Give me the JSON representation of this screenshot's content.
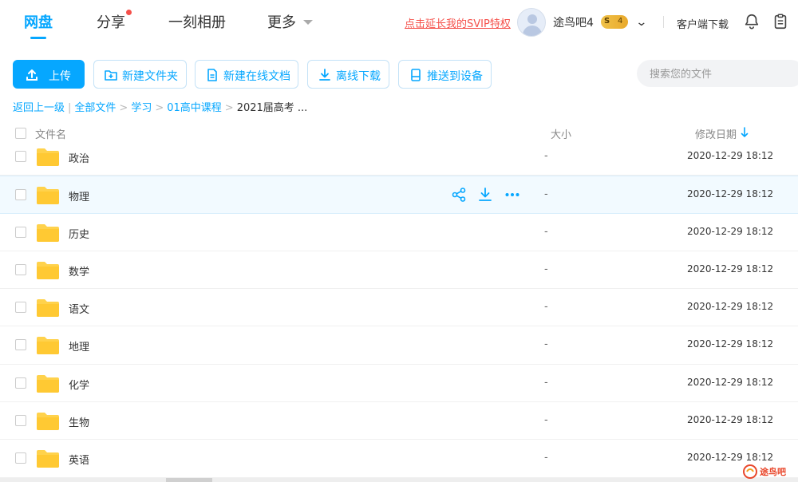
{
  "nav": {
    "tabs": [
      {
        "label": "网盘",
        "active": true
      },
      {
        "label": "分享",
        "badge_dot": true
      },
      {
        "label": "一刻相册"
      },
      {
        "label": "更多"
      }
    ]
  },
  "topbar": {
    "svip_link": "点击延长我的SVIP特权",
    "username": "途鸟吧4",
    "vip_badge": {
      "letter": "S",
      "level": "4"
    },
    "client_download": "客户端下载",
    "icons": [
      "bell-icon",
      "clipboard-icon"
    ]
  },
  "toolbar": {
    "upload": "上传",
    "new_folder": "新建文件夹",
    "new_online_doc": "新建在线文档",
    "offline_download": "离线下载",
    "push_to_device": "推送到设备",
    "search_placeholder": "搜索您的文件"
  },
  "breadcrumb": {
    "back": "返回上一级",
    "items": [
      "全部文件",
      "学习",
      "01高中课程"
    ],
    "current": "2021届高考 ..."
  },
  "table": {
    "columns": {
      "name": "文件名",
      "size": "大小",
      "date": "修改日期"
    },
    "rows": [
      {
        "name": "政治",
        "size": "-",
        "date": "2020-12-29 18:12"
      },
      {
        "name": "物理",
        "size": "-",
        "date": "2020-12-29 18:12",
        "hover": true
      },
      {
        "name": "历史",
        "size": "-",
        "date": "2020-12-29 18:12"
      },
      {
        "name": "数学",
        "size": "-",
        "date": "2020-12-29 18:12"
      },
      {
        "name": "语文",
        "size": "-",
        "date": "2020-12-29 18:12"
      },
      {
        "name": "地理",
        "size": "-",
        "date": "2020-12-29 18:12"
      },
      {
        "name": "化学",
        "size": "-",
        "date": "2020-12-29 18:12"
      },
      {
        "name": "生物",
        "size": "-",
        "date": "2020-12-29 18:12"
      },
      {
        "name": "英语",
        "size": "-",
        "date": "2020-12-29 18:12"
      }
    ]
  },
  "watermark": {
    "text": "途鸟吧"
  },
  "colors": {
    "accent": "#06a7ff",
    "alert": "#f5504a",
    "folder": "#ffd24c"
  }
}
